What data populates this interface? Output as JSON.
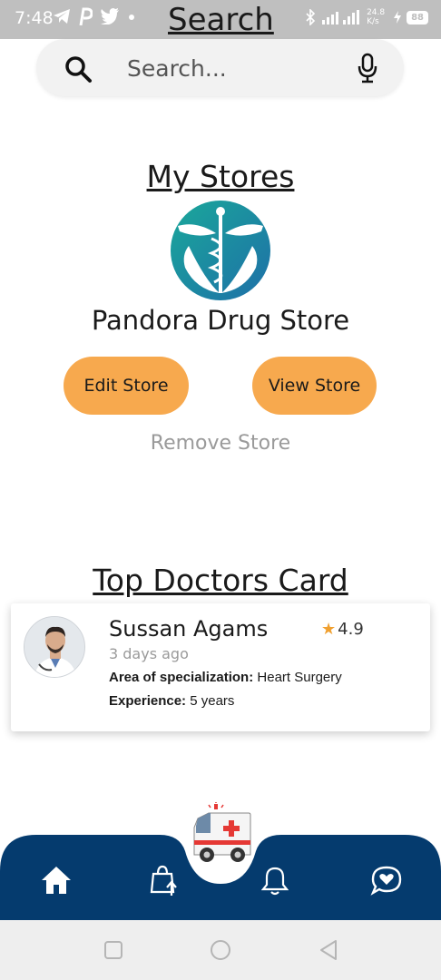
{
  "status_bar": {
    "time": "7:48",
    "title": "Search",
    "network_speed": "24.8 K/s",
    "battery": "88"
  },
  "search": {
    "placeholder": "Search..."
  },
  "stores": {
    "title": "My Stores",
    "store_name": "Pandora Drug Store",
    "edit_label": "Edit Store",
    "view_label": "View Store",
    "remove_label": "Remove Store"
  },
  "doctors": {
    "title": "Top Doctors Card",
    "card": {
      "name": "Sussan Agams",
      "rating": "4.9",
      "time": "3 days ago",
      "specialization_label": "Area of specialization:",
      "specialization_value": "Heart Surgery",
      "experience_label": "Experience:",
      "experience_value": "5 years"
    }
  },
  "bottom_nav": {
    "items": [
      {
        "icon": "home-icon"
      },
      {
        "icon": "shopping-bag-upload-icon"
      },
      {
        "icon": "bell-icon"
      },
      {
        "icon": "chat-heart-icon"
      }
    ],
    "center_icon": "ambulance-icon"
  },
  "colors": {
    "accent_orange": "#f7a94e",
    "nav_blue": "#053b6e",
    "status_gray": "#bfbfbf"
  }
}
